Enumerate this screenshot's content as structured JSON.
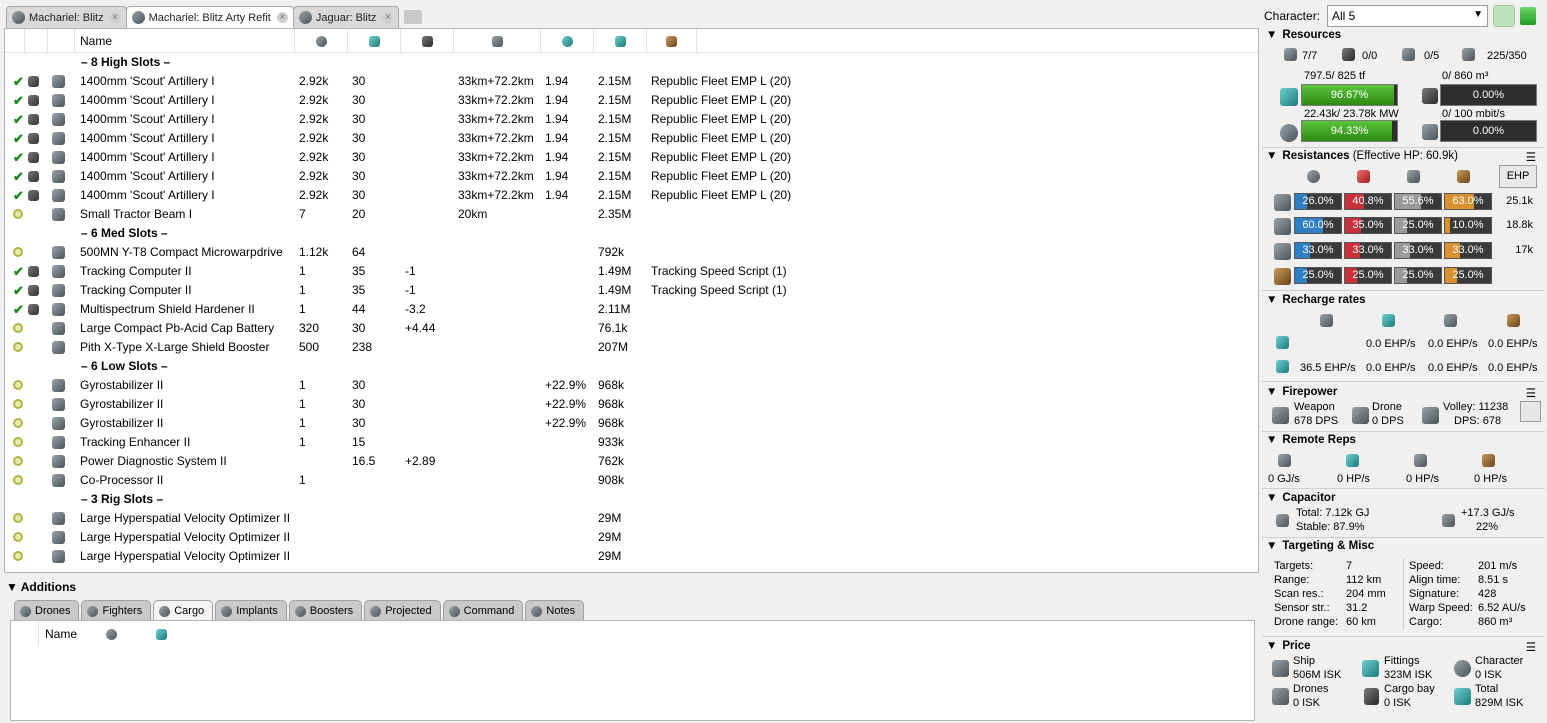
{
  "fit_tabs": [
    {
      "label": "Machariel: Blitz",
      "active": false
    },
    {
      "label": "Machariel: Blitz Arty Refit",
      "active": true
    },
    {
      "label": "Jaguar: Blitz",
      "active": false
    }
  ],
  "columns": {
    "name": "Name"
  },
  "rows": [
    {
      "type": "header",
      "label": "– 8 High Slots –"
    },
    {
      "type": "item",
      "state": "active",
      "name": "1400mm 'Scout' Artillery I",
      "cpu": "2.92k",
      "pg": "30",
      "cap": "",
      "range": "33km+72.2km",
      "rof": "1.94",
      "price": "2.15M",
      "charge": "Republic Fleet EMP L (20)"
    },
    {
      "type": "item",
      "state": "active",
      "name": "1400mm 'Scout' Artillery I",
      "cpu": "2.92k",
      "pg": "30",
      "cap": "",
      "range": "33km+72.2km",
      "rof": "1.94",
      "price": "2.15M",
      "charge": "Republic Fleet EMP L (20)"
    },
    {
      "type": "item",
      "state": "active",
      "name": "1400mm 'Scout' Artillery I",
      "cpu": "2.92k",
      "pg": "30",
      "cap": "",
      "range": "33km+72.2km",
      "rof": "1.94",
      "price": "2.15M",
      "charge": "Republic Fleet EMP L (20)"
    },
    {
      "type": "item",
      "state": "active",
      "name": "1400mm 'Scout' Artillery I",
      "cpu": "2.92k",
      "pg": "30",
      "cap": "",
      "range": "33km+72.2km",
      "rof": "1.94",
      "price": "2.15M",
      "charge": "Republic Fleet EMP L (20)"
    },
    {
      "type": "item",
      "state": "active",
      "name": "1400mm 'Scout' Artillery I",
      "cpu": "2.92k",
      "pg": "30",
      "cap": "",
      "range": "33km+72.2km",
      "rof": "1.94",
      "price": "2.15M",
      "charge": "Republic Fleet EMP L (20)"
    },
    {
      "type": "item",
      "state": "active",
      "name": "1400mm 'Scout' Artillery I",
      "cpu": "2.92k",
      "pg": "30",
      "cap": "",
      "range": "33km+72.2km",
      "rof": "1.94",
      "price": "2.15M",
      "charge": "Republic Fleet EMP L (20)"
    },
    {
      "type": "item",
      "state": "active",
      "name": "1400mm 'Scout' Artillery I",
      "cpu": "2.92k",
      "pg": "30",
      "cap": "",
      "range": "33km+72.2km",
      "rof": "1.94",
      "price": "2.15M",
      "charge": "Republic Fleet EMP L (20)"
    },
    {
      "type": "item",
      "state": "online",
      "name": "Small Tractor Beam I",
      "cpu": "7",
      "pg": "20",
      "cap": "",
      "range": "20km",
      "rof": "",
      "price": "2.35M",
      "charge": ""
    },
    {
      "type": "header",
      "label": "– 6 Med Slots –"
    },
    {
      "type": "item",
      "state": "online",
      "name": "500MN Y-T8 Compact Microwarpdrive",
      "cpu": "1.12k",
      "pg": "64",
      "cap": "",
      "range": "",
      "rof": "",
      "price": "792k",
      "charge": ""
    },
    {
      "type": "item",
      "state": "active",
      "name": "Tracking Computer II",
      "cpu": "1",
      "pg": "35",
      "cap": "-1",
      "range": "",
      "rof": "",
      "price": "1.49M",
      "charge": "Tracking Speed Script (1)"
    },
    {
      "type": "item",
      "state": "active",
      "name": "Tracking Computer II",
      "cpu": "1",
      "pg": "35",
      "cap": "-1",
      "range": "",
      "rof": "",
      "price": "1.49M",
      "charge": "Tracking Speed Script (1)"
    },
    {
      "type": "item",
      "state": "active",
      "name": "Multispectrum Shield Hardener II",
      "cpu": "1",
      "pg": "44",
      "cap": "-3.2",
      "range": "",
      "rof": "",
      "price": "2.11M",
      "charge": ""
    },
    {
      "type": "item",
      "state": "online",
      "name": "Large Compact Pb-Acid Cap Battery",
      "cpu": "320",
      "pg": "30",
      "cap": "+4.44",
      "range": "",
      "rof": "",
      "price": "76.1k",
      "charge": ""
    },
    {
      "type": "item",
      "state": "online",
      "name": "Pith X-Type X-Large Shield Booster",
      "cpu": "500",
      "pg": "238",
      "cap": "",
      "range": "",
      "rof": "",
      "price": "207M",
      "charge": ""
    },
    {
      "type": "header",
      "label": "– 6 Low Slots –"
    },
    {
      "type": "item",
      "state": "online",
      "name": "Gyrostabilizer II",
      "cpu": "1",
      "pg": "30",
      "cap": "",
      "range": "",
      "rof": "+22.9%",
      "price": "968k",
      "charge": ""
    },
    {
      "type": "item",
      "state": "online",
      "name": "Gyrostabilizer II",
      "cpu": "1",
      "pg": "30",
      "cap": "",
      "range": "",
      "rof": "+22.9%",
      "price": "968k",
      "charge": ""
    },
    {
      "type": "item",
      "state": "online",
      "name": "Gyrostabilizer II",
      "cpu": "1",
      "pg": "30",
      "cap": "",
      "range": "",
      "rof": "+22.9%",
      "price": "968k",
      "charge": ""
    },
    {
      "type": "item",
      "state": "online",
      "name": "Tracking Enhancer II",
      "cpu": "1",
      "pg": "15",
      "cap": "",
      "range": "",
      "rof": "",
      "price": "933k",
      "charge": ""
    },
    {
      "type": "item",
      "state": "online",
      "name": "Power Diagnostic System II",
      "cpu": "",
      "pg": "16.5",
      "cap": "+2.89",
      "range": "",
      "rof": "",
      "price": "762k",
      "charge": ""
    },
    {
      "type": "item",
      "state": "online",
      "name": "Co-Processor II",
      "cpu": "1",
      "pg": "",
      "cap": "",
      "range": "",
      "rof": "",
      "price": "908k",
      "charge": ""
    },
    {
      "type": "header",
      "label": "– 3 Rig Slots –"
    },
    {
      "type": "item",
      "state": "online",
      "name": "Large Hyperspatial Velocity Optimizer II",
      "cpu": "",
      "pg": "",
      "cap": "",
      "range": "",
      "rof": "",
      "price": "29M",
      "charge": ""
    },
    {
      "type": "item",
      "state": "online",
      "name": "Large Hyperspatial Velocity Optimizer II",
      "cpu": "",
      "pg": "",
      "cap": "",
      "range": "",
      "rof": "",
      "price": "29M",
      "charge": ""
    },
    {
      "type": "item",
      "state": "online",
      "name": "Large Hyperspatial Velocity Optimizer II",
      "cpu": "",
      "pg": "",
      "cap": "",
      "range": "",
      "rof": "",
      "price": "29M",
      "charge": ""
    }
  ],
  "additions": {
    "title": "Additions",
    "tabs": [
      "Drones",
      "Fighters",
      "Cargo",
      "Implants",
      "Boosters",
      "Projected",
      "Command",
      "Notes"
    ],
    "active_tab": "Cargo",
    "col_name": "Name"
  },
  "character": {
    "label": "Character:",
    "value": "All 5"
  },
  "resources": {
    "title": "Resources",
    "counts": [
      "7/7",
      "0/0",
      "0/5",
      "225/350"
    ],
    "cpu_text": "797.5/ 825 tf",
    "cpu_pct": 96.67,
    "cpu_label": "96.67%",
    "calib_text": "0/ 860 m³",
    "calib_pct": 0,
    "calib_label": "0.00%",
    "pg_text": "22.43k/ 23.78k MW",
    "pg_pct": 94.33,
    "pg_label": "94.33%",
    "bw_text": "0/ 100 mbit/s",
    "bw_pct": 0,
    "bw_label": "0.00%"
  },
  "resistances": {
    "title": "Resistances",
    "ehp_text": "(Effective HP: 60.9k)",
    "ehp_button": "EHP",
    "rows": [
      {
        "vals": [
          "26.0%",
          "40.8%",
          "55.6%",
          "63.0%"
        ],
        "pcts": [
          26,
          40.8,
          55.6,
          63
        ],
        "ehp": "25.1k"
      },
      {
        "vals": [
          "60.0%",
          "35.0%",
          "25.0%",
          "10.0%"
        ],
        "pcts": [
          60,
          35,
          25,
          10
        ],
        "ehp": "18.8k"
      },
      {
        "vals": [
          "33.0%",
          "33.0%",
          "33.0%",
          "33.0%"
        ],
        "pcts": [
          33,
          33,
          33,
          33
        ],
        "ehp": "17k"
      },
      {
        "vals": [
          "25.0%",
          "25.0%",
          "25.0%",
          "25.0%"
        ],
        "pcts": [
          25,
          25,
          25,
          25
        ],
        "ehp": ""
      }
    ],
    "colors": [
      "#2f7fc4",
      "#c8313a",
      "#9a9a9a",
      "#d9902f"
    ]
  },
  "recharge": {
    "title": "Recharge rates",
    "row1": [
      "0.0 EHP/s",
      "0.0 EHP/s",
      "0.0 EHP/s"
    ],
    "row2": [
      "36.5 EHP/s",
      "0.0 EHP/s",
      "0.0 EHP/s",
      "0.0 EHP/s"
    ]
  },
  "firepower": {
    "title": "Firepower",
    "weapon_label": "Weapon",
    "weapon_dps": "678 DPS",
    "drone_label": "Drone",
    "drone_dps": "0 DPS",
    "volley": "Volley: 11238",
    "dps": "DPS: 678"
  },
  "remote_reps": {
    "title": "Remote Reps",
    "vals": [
      "0 GJ/s",
      "0 HP/s",
      "0 HP/s",
      "0 HP/s"
    ]
  },
  "capacitor": {
    "title": "Capacitor",
    "total": "Total: 7.12k GJ",
    "stable": "Stable: 87.9%",
    "rate": "+17.3 GJ/s",
    "rate_pct": "22%"
  },
  "targeting": {
    "title": "Targeting & Misc",
    "left": [
      [
        "Targets:",
        "7"
      ],
      [
        "Range:",
        "112 km"
      ],
      [
        "Scan res.:",
        "204 mm"
      ],
      [
        "Sensor str.:",
        "31.2"
      ],
      [
        "Drone range:",
        "60 km"
      ]
    ],
    "right": [
      [
        "Speed:",
        "201 m/s"
      ],
      [
        "Align time:",
        "8.51 s"
      ],
      [
        "Signature:",
        "428"
      ],
      [
        "Warp Speed:",
        "6.52 AU/s"
      ],
      [
        "Cargo:",
        "860 m³"
      ]
    ]
  },
  "price": {
    "title": "Price",
    "ship_label": "Ship",
    "ship": "506M ISK",
    "fittings_label": "Fittings",
    "fittings": "323M ISK",
    "character_label": "Character",
    "character": "0 ISK",
    "drones_label": "Drones",
    "drones": "0 ISK",
    "cargo_label": "Cargo bay",
    "cargo": "0 ISK",
    "total_label": "Total",
    "total": "829M ISK"
  }
}
